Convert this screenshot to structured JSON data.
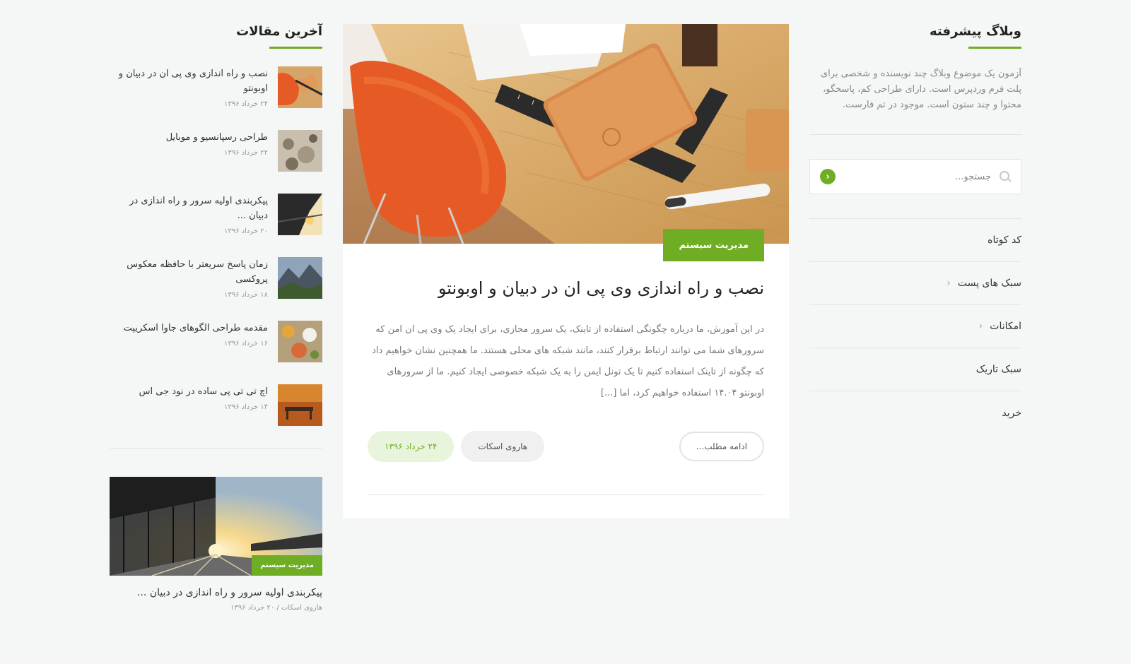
{
  "right_sidebar": {
    "title": "وبلاگ پیشرفته",
    "about": "آزمون یک موضوع وبلاگ چند نویسنده و شخصی برای پلت فرم وردپرس است. دارای طراحی کم، پاسخگو، محتوا و چند ستون است. موجود در تم فارست.",
    "search_placeholder": "جستجو...",
    "menu": [
      {
        "label": "کد کوتاه",
        "has_submenu": false
      },
      {
        "label": "سبک های پست",
        "has_submenu": true
      },
      {
        "label": "امکانات",
        "has_submenu": true
      },
      {
        "label": "سبک تاریک",
        "has_submenu": false
      },
      {
        "label": "خرید",
        "has_submenu": false
      }
    ],
    "chevron": "‹",
    "submit_arrow": "‹"
  },
  "main_post": {
    "category": "مدیریت سیستم",
    "title": "نصب و راه اندازی وی پی ان در دبیان و اوبونتو",
    "excerpt": "در این آموزش، ما درباره چگونگی استفاده از تاینک، یک سرور مجازی، برای ایجاد یک وی پی ان امن که سرورهای شما می توانند ارتباط برقرار کنند، مانند شبکه های محلی هستند. ما همچنین نشان خواهیم داد که چگونه از تاینک استفاده کنیم تا یک تونل ایمن را به یک شبکه خصوصی ایجاد کنیم. ما از سرورهای اوبونتو ۱۴.۰۴ استفاده خواهیم کرد، اما [...]",
    "read_more": "ادامه مطلب...",
    "author": "هاروی اسکات",
    "date": "۲۴ خرداد ۱۳۹۶"
  },
  "left_sidebar": {
    "title": "آخرین مقالات",
    "recent_posts": [
      {
        "title": "نصب و راه اندازی وی پی ان در دبیان و اوبونتو",
        "date": "۲۴ خرداد ۱۳۹۶"
      },
      {
        "title": "طراحی رسپانسیو و موبایل",
        "date": "۲۲ خرداد ۱۳۹۶"
      },
      {
        "title": "پیکربندی اولیه سرور و راه اندازی در دبیان ...",
        "date": "۲۰ خرداد ۱۳۹۶"
      },
      {
        "title": "زمان پاسخ سریعتر با حافظه معکوس پروکسی",
        "date": "۱۸ خرداد ۱۳۹۶"
      },
      {
        "title": "مقدمه طراحی الگوهای جاوا اسکریپت",
        "date": "۱۶ خرداد ۱۳۹۶"
      },
      {
        "title": "اچ تی تی پی ساده در نود جی اس",
        "date": "۱۴ خرداد ۱۳۹۶"
      }
    ],
    "featured_card": {
      "category": "مدیریت سیستم",
      "title": "پیکربندی اولیه سرور و راه اندازی در دبیان ...",
      "meta": "هاروی اسکات / ۲۰ خرداد ۱۳۹۶"
    }
  },
  "colors": {
    "accent": "#6fae24",
    "background": "#f5f6f6"
  }
}
